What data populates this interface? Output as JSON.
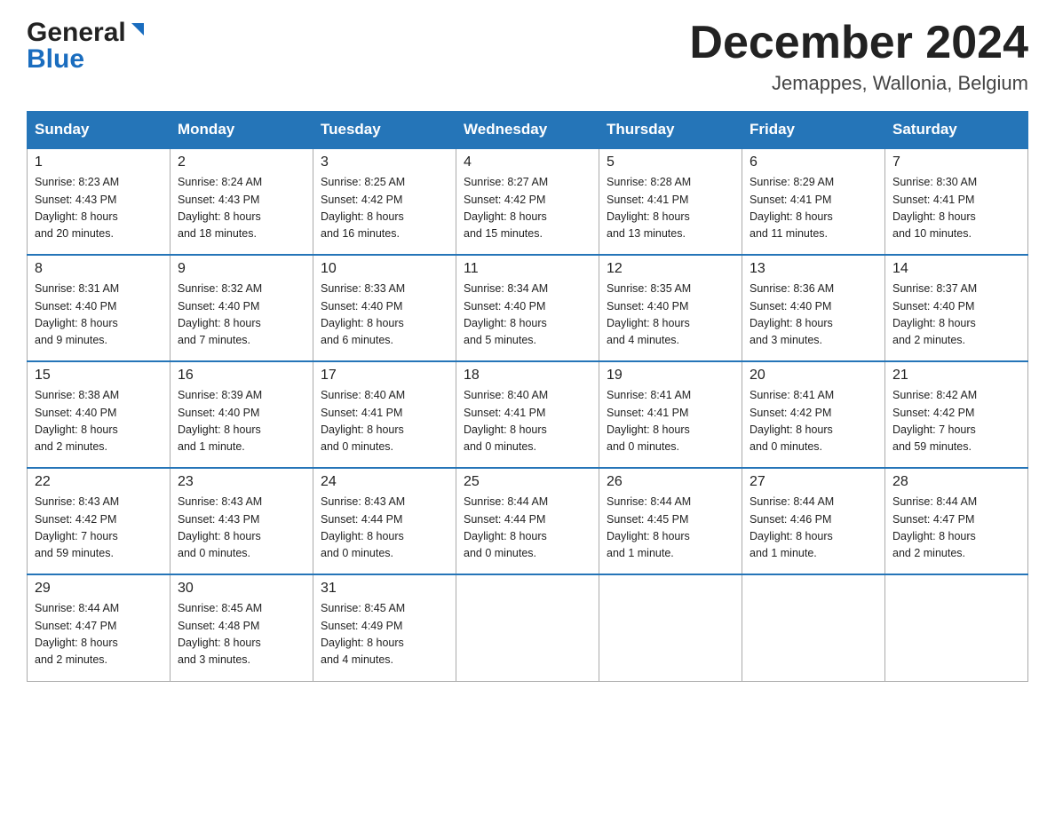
{
  "header": {
    "logo_general": "General",
    "logo_blue": "Blue",
    "month_title": "December 2024",
    "location": "Jemappes, Wallonia, Belgium"
  },
  "days_of_week": [
    "Sunday",
    "Monday",
    "Tuesday",
    "Wednesday",
    "Thursday",
    "Friday",
    "Saturday"
  ],
  "weeks": [
    [
      {
        "day": "1",
        "sunrise": "8:23 AM",
        "sunset": "4:43 PM",
        "daylight": "8 hours and 20 minutes."
      },
      {
        "day": "2",
        "sunrise": "8:24 AM",
        "sunset": "4:43 PM",
        "daylight": "8 hours and 18 minutes."
      },
      {
        "day": "3",
        "sunrise": "8:25 AM",
        "sunset": "4:42 PM",
        "daylight": "8 hours and 16 minutes."
      },
      {
        "day": "4",
        "sunrise": "8:27 AM",
        "sunset": "4:42 PM",
        "daylight": "8 hours and 15 minutes."
      },
      {
        "day": "5",
        "sunrise": "8:28 AM",
        "sunset": "4:41 PM",
        "daylight": "8 hours and 13 minutes."
      },
      {
        "day": "6",
        "sunrise": "8:29 AM",
        "sunset": "4:41 PM",
        "daylight": "8 hours and 11 minutes."
      },
      {
        "day": "7",
        "sunrise": "8:30 AM",
        "sunset": "4:41 PM",
        "daylight": "8 hours and 10 minutes."
      }
    ],
    [
      {
        "day": "8",
        "sunrise": "8:31 AM",
        "sunset": "4:40 PM",
        "daylight": "8 hours and 9 minutes."
      },
      {
        "day": "9",
        "sunrise": "8:32 AM",
        "sunset": "4:40 PM",
        "daylight": "8 hours and 7 minutes."
      },
      {
        "day": "10",
        "sunrise": "8:33 AM",
        "sunset": "4:40 PM",
        "daylight": "8 hours and 6 minutes."
      },
      {
        "day": "11",
        "sunrise": "8:34 AM",
        "sunset": "4:40 PM",
        "daylight": "8 hours and 5 minutes."
      },
      {
        "day": "12",
        "sunrise": "8:35 AM",
        "sunset": "4:40 PM",
        "daylight": "8 hours and 4 minutes."
      },
      {
        "day": "13",
        "sunrise": "8:36 AM",
        "sunset": "4:40 PM",
        "daylight": "8 hours and 3 minutes."
      },
      {
        "day": "14",
        "sunrise": "8:37 AM",
        "sunset": "4:40 PM",
        "daylight": "8 hours and 2 minutes."
      }
    ],
    [
      {
        "day": "15",
        "sunrise": "8:38 AM",
        "sunset": "4:40 PM",
        "daylight": "8 hours and 2 minutes."
      },
      {
        "day": "16",
        "sunrise": "8:39 AM",
        "sunset": "4:40 PM",
        "daylight": "8 hours and 1 minute."
      },
      {
        "day": "17",
        "sunrise": "8:40 AM",
        "sunset": "4:41 PM",
        "daylight": "8 hours and 0 minutes."
      },
      {
        "day": "18",
        "sunrise": "8:40 AM",
        "sunset": "4:41 PM",
        "daylight": "8 hours and 0 minutes."
      },
      {
        "day": "19",
        "sunrise": "8:41 AM",
        "sunset": "4:41 PM",
        "daylight": "8 hours and 0 minutes."
      },
      {
        "day": "20",
        "sunrise": "8:41 AM",
        "sunset": "4:42 PM",
        "daylight": "8 hours and 0 minutes."
      },
      {
        "day": "21",
        "sunrise": "8:42 AM",
        "sunset": "4:42 PM",
        "daylight": "7 hours and 59 minutes."
      }
    ],
    [
      {
        "day": "22",
        "sunrise": "8:43 AM",
        "sunset": "4:42 PM",
        "daylight": "7 hours and 59 minutes."
      },
      {
        "day": "23",
        "sunrise": "8:43 AM",
        "sunset": "4:43 PM",
        "daylight": "8 hours and 0 minutes."
      },
      {
        "day": "24",
        "sunrise": "8:43 AM",
        "sunset": "4:44 PM",
        "daylight": "8 hours and 0 minutes."
      },
      {
        "day": "25",
        "sunrise": "8:44 AM",
        "sunset": "4:44 PM",
        "daylight": "8 hours and 0 minutes."
      },
      {
        "day": "26",
        "sunrise": "8:44 AM",
        "sunset": "4:45 PM",
        "daylight": "8 hours and 1 minute."
      },
      {
        "day": "27",
        "sunrise": "8:44 AM",
        "sunset": "4:46 PM",
        "daylight": "8 hours and 1 minute."
      },
      {
        "day": "28",
        "sunrise": "8:44 AM",
        "sunset": "4:47 PM",
        "daylight": "8 hours and 2 minutes."
      }
    ],
    [
      {
        "day": "29",
        "sunrise": "8:44 AM",
        "sunset": "4:47 PM",
        "daylight": "8 hours and 2 minutes."
      },
      {
        "day": "30",
        "sunrise": "8:45 AM",
        "sunset": "4:48 PM",
        "daylight": "8 hours and 3 minutes."
      },
      {
        "day": "31",
        "sunrise": "8:45 AM",
        "sunset": "4:49 PM",
        "daylight": "8 hours and 4 minutes."
      },
      null,
      null,
      null,
      null
    ]
  ],
  "labels": {
    "sunrise": "Sunrise:",
    "sunset": "Sunset:",
    "daylight": "Daylight:"
  }
}
